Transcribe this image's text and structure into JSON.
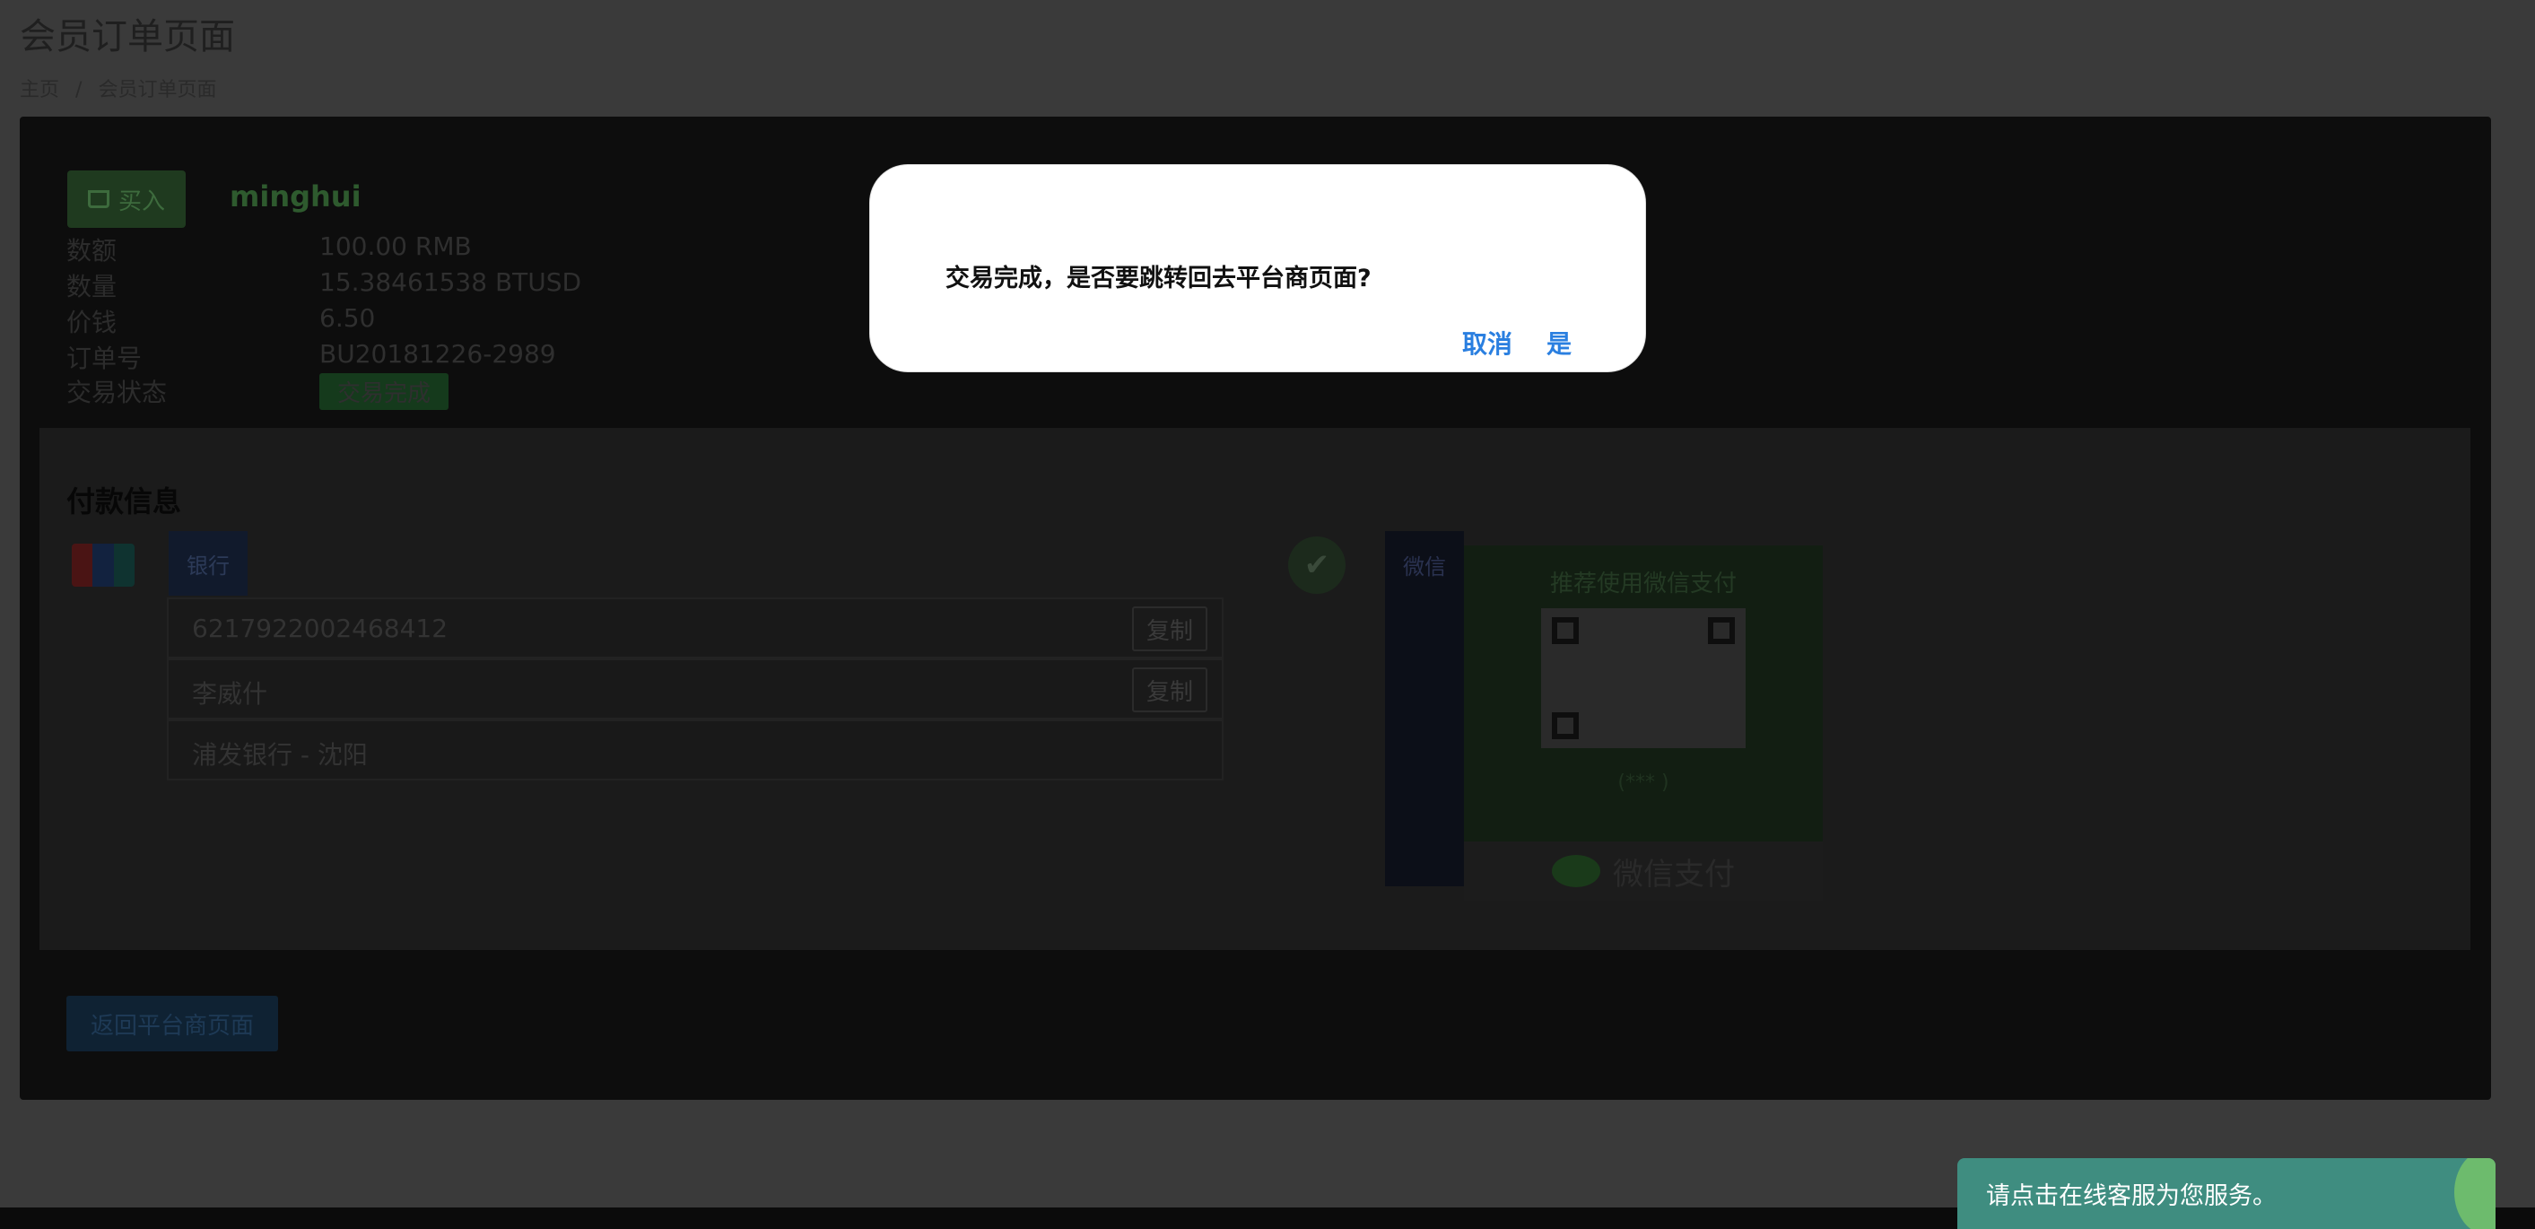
{
  "page": {
    "title": "会员订单页面",
    "breadcrumb": [
      "主页",
      "会员订单页面"
    ]
  },
  "order": {
    "buy_label": "买入",
    "username": "minghui",
    "rows": [
      {
        "label": "数额",
        "value": "100.00 RMB"
      },
      {
        "label": "数量",
        "value": "15.38461538 BTUSD"
      },
      {
        "label": "价钱",
        "value": "6.50"
      },
      {
        "label": "订单号",
        "value": "BU20181226-2989"
      },
      {
        "label": "交易状态",
        "value": "交易完成"
      }
    ]
  },
  "payment": {
    "title": "付款信息",
    "bank_tab": "银行",
    "card_number": "6217922002468412",
    "account_name": "李威什",
    "bank_name": "浦发银行 - 沈阳",
    "copy_label": "复制",
    "wechat_tab": "微信",
    "wechat_recommend": "推荐使用微信支付",
    "wechat_name": "(*** )",
    "wechat_pay": "微信支付"
  },
  "return_button": "返回平台商页面",
  "chat": {
    "message": "请点击在线客服为您服务。"
  },
  "modal": {
    "message": "交易完成，是否要跳转回去平台商页面?",
    "cancel": "取消",
    "confirm": "是",
    "accent": "#2a7fe0"
  }
}
